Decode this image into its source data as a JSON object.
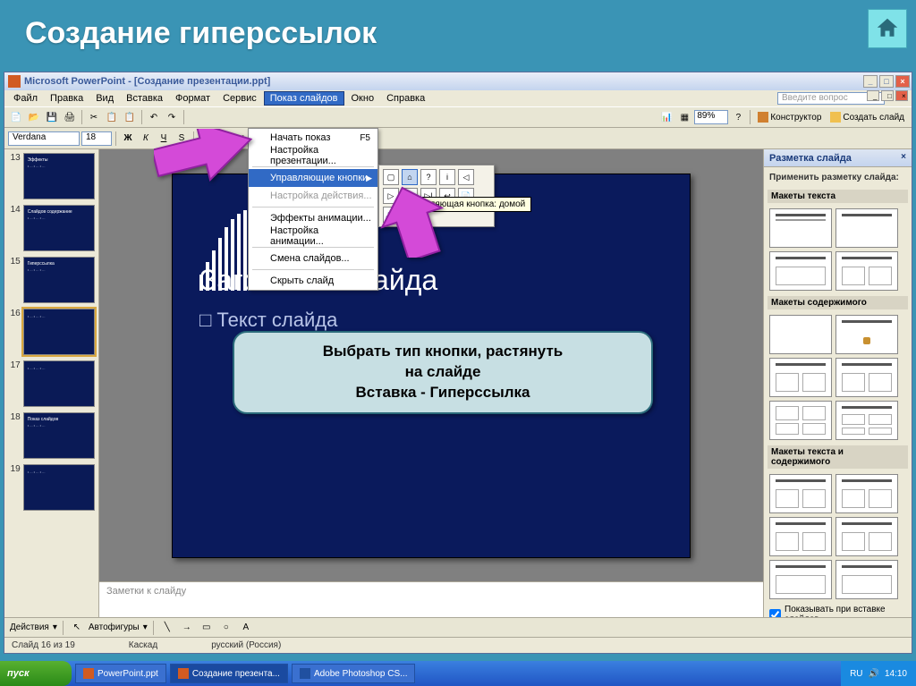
{
  "page_title": "Создание гиперссылок",
  "powerpoint": {
    "titlebar": "Microsoft PowerPoint - [Создание презентации.ppt]",
    "ask_placeholder": "Введите вопрос",
    "menubar": [
      "Файл",
      "Правка",
      "Вид",
      "Вставка",
      "Формат",
      "Сервис",
      "Показ слайдов",
      "Окно",
      "Справка"
    ],
    "active_menu": "Показ слайдов",
    "zoom": "89%",
    "konstruktor": "Конструктор",
    "create_slide": "Создать слайд",
    "font": "Verdana",
    "font_size": "18",
    "thumbs": [
      {
        "num": "13",
        "title": "Эффекты",
        "sel": false
      },
      {
        "num": "14",
        "title": "Слайдов содержание",
        "sel": false
      },
      {
        "num": "15",
        "title": "Гиперссылка",
        "sel": false
      },
      {
        "num": "16",
        "title": "",
        "sel": true
      },
      {
        "num": "17",
        "title": "",
        "sel": false
      },
      {
        "num": "18",
        "title": "Показ слайдов",
        "sel": false
      },
      {
        "num": "19",
        "title": "",
        "sel": false
      }
    ],
    "slide": {
      "heading": "Заголовок слайда",
      "body": "Текст слайда"
    },
    "notes_placeholder": "Заметки к слайду",
    "taskpane": {
      "title": "Разметка слайда",
      "label": "Применить разметку слайда:",
      "section1": "Макеты текста",
      "section2": "Макеты содержимого",
      "section3": "Макеты текста и содержимого",
      "checkbox": "Показывать при вставке слайдов"
    },
    "draw_toolbar": {
      "actions": "Действия",
      "autoshapes": "Автофигуры"
    },
    "statusbar": {
      "slide_pos": "Слайд 16 из 19",
      "template": "Каскад",
      "lang": "русский (Россия)"
    }
  },
  "dropdown": {
    "items": [
      {
        "label": "Начать показ",
        "kb": "F5"
      },
      {
        "label": "Настройка презентации..."
      },
      {
        "sep": true
      },
      {
        "label": "Управляющие кнопки",
        "arrow": true,
        "hl": true
      },
      {
        "label": "Настройка действия...",
        "disabled": true
      },
      {
        "sep": true
      },
      {
        "label": "Эффекты анимации..."
      },
      {
        "label": "Настройка анимации..."
      },
      {
        "sep": true
      },
      {
        "label": "Смена слайдов..."
      },
      {
        "sep": true
      },
      {
        "label": "Скрыть слайд"
      }
    ]
  },
  "submenu_tooltip": "Управляющая кнопка: домой",
  "callout": {
    "line1": "Выбрать тип кнопки, растянуть",
    "line2": "на слайде",
    "line3": "Вставка - Гиперссылка"
  },
  "taskbar": {
    "start": "пуск",
    "items": [
      "PowerPoint.ppt",
      "Создание презента...",
      "Adobe Photoshop CS..."
    ],
    "lang": "RU",
    "time": "14:10"
  }
}
